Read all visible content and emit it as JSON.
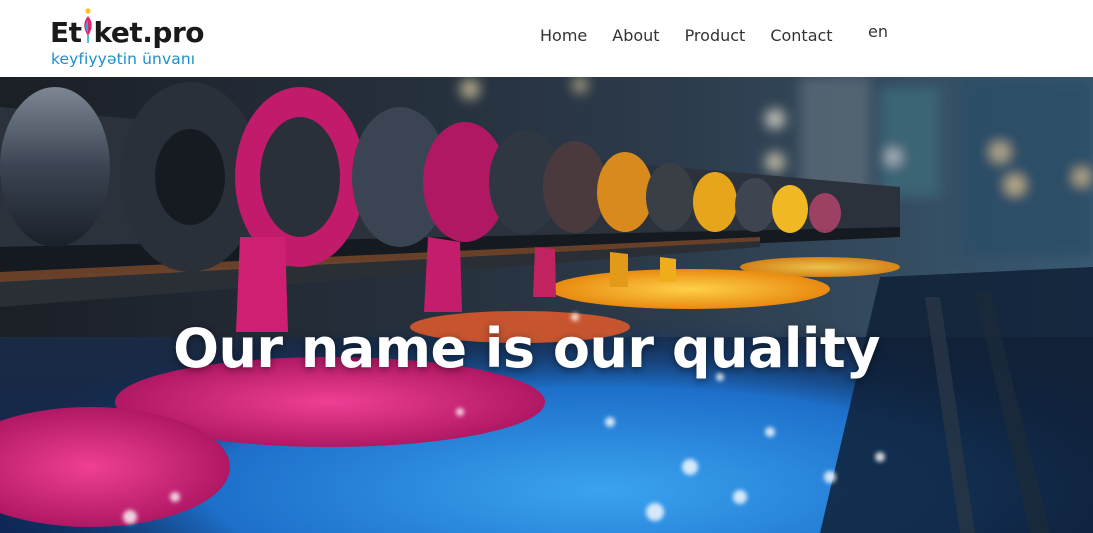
{
  "brand": {
    "name_part1": "Et",
    "name_part2": "ket.pro",
    "tagline": "keyfiyyətin ünvanı",
    "colors": {
      "wordmark": "#1a1a1a",
      "tagline": "#1e8fc6",
      "pen_cyan": "#1fb5e8",
      "pen_magenta": "#e0266e",
      "pen_yellow": "#f7c21a"
    }
  },
  "nav": {
    "items": [
      {
        "label": "Home"
      },
      {
        "label": "About"
      },
      {
        "label": "Product"
      },
      {
        "label": "Contact"
      }
    ],
    "language": "en"
  },
  "hero": {
    "headline": "Our name is our quality",
    "image": "printing-press-rollers-with-magenta-yellow-and-cyan-ink",
    "colors": {
      "magenta": "#d4237a",
      "yellow": "#f5b51e",
      "cyan": "#2a8fe0",
      "steel": "#3a4452"
    }
  }
}
